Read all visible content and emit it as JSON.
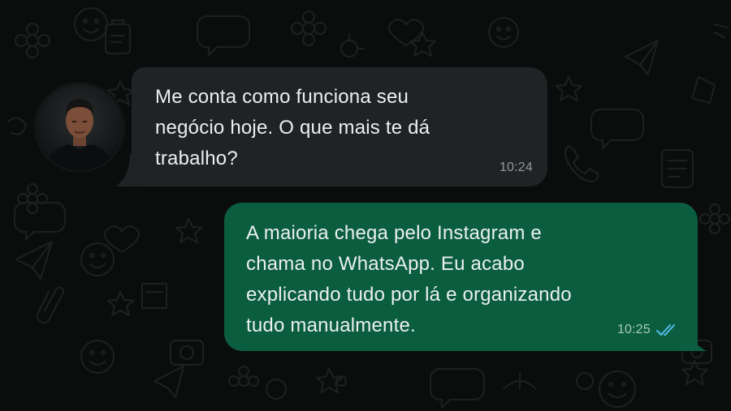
{
  "chat": {
    "messages": [
      {
        "direction": "incoming",
        "text": "Me conta como funciona seu\nnegócio hoje. O que mais te dá\ntrabalho?",
        "time": "10:24"
      },
      {
        "direction": "outgoing",
        "text": "A maioria chega pelo Instagram e\nchama no WhatsApp. Eu acabo\nexplicando tudo por lá e organizando\ntudo manualmente.",
        "time": "10:25",
        "status": "read",
        "status_icon": "double-check-icon"
      }
    ]
  },
  "colors": {
    "background": "#0b0c0c",
    "incoming_bubble": "#202326",
    "outgoing_bubble": "#0b5d40",
    "read_ticks": "#53bdeb",
    "text": "#eaf0ee"
  }
}
